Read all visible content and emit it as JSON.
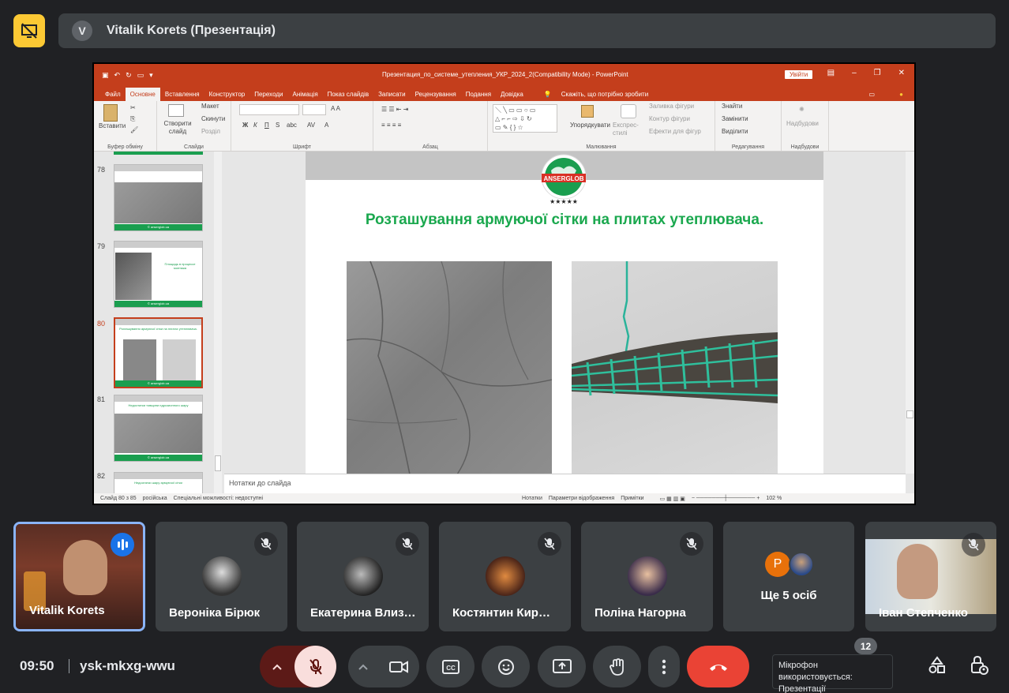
{
  "colors": {
    "accent": "#8ab4f8",
    "present_yellow": "#fcc934",
    "end_call": "#ea4335",
    "mic_muted_bg": "#f9dedc",
    "ppt_red": "#c43e1c",
    "slide_green": "#1aa84e"
  },
  "presenter": {
    "avatar_letter": "V",
    "title": "Vitalik Korets (Презентація)"
  },
  "ppt": {
    "doc_title": "Презентация_по_системе_утепления_УКР_2024_2(Compatibility Mode)  -  PowerPoint",
    "signin": "Увійти",
    "tabs": [
      "Файл",
      "Основне",
      "Вставлення",
      "Конструктор",
      "Переходи",
      "Анімація",
      "Показ слайдів",
      "Записати",
      "Рецензування",
      "Подання",
      "Довідка"
    ],
    "active_tab": "Основне",
    "tell_me": "Скажіть, що потрібно зробити",
    "ribbon": {
      "paste": "Вставити",
      "new_slide": "Створити слайд",
      "layout": "Макет",
      "reset": "Скинути",
      "section": "Розділ",
      "font_label": "Шрифт",
      "paragraph_label": "Абзац",
      "clipboard_label": "Буфер обміну",
      "slides_label": "Слайди",
      "drawing_label": "Малювання",
      "arrange": "Упорядкувати",
      "quick_styles": "Експрес-стилі",
      "fill": "Заливка фігури",
      "outline": "Контур фігури",
      "effects": "Ефекти для фігур",
      "find": "Знайти",
      "replace": "Замінити",
      "select": "Виділити",
      "editing_label": "Редагування",
      "addins": "Надбудови",
      "addins_label": "Надбудови"
    },
    "thumbnails": [
      {
        "num": "78",
        "title": "",
        "footer": "© anserglob.ua"
      },
      {
        "num": "79",
        "title": "Площадь в процессе монтажа",
        "footer": "© anserglob.ua"
      },
      {
        "num": "80",
        "title": "Розташування армуючої сітки на плитах утеплювача.",
        "footer": "© anserglob.ua"
      },
      {
        "num": "81",
        "title": "Недоотатки товщини пдрозионного шару",
        "footer": "© anserglob.ua"
      },
      {
        "num": "82",
        "title": "Недоотатки шару армуючої сітки",
        "footer": ""
      }
    ],
    "slide": {
      "logo_text": "ANSERGLOB",
      "title": "Розташування армуючої сітки на плитах утеплювача."
    },
    "notes": "Нотатки до слайда",
    "status": {
      "slide": "Слайд 80 з 85",
      "lang": "російська",
      "access": "Спеціальні можливості: недоступні",
      "notes": "Нотатки",
      "view": "Параметри відображення",
      "comments": "Примітки",
      "zoom": "102 %"
    }
  },
  "participants": [
    {
      "name": "Vitalik Korets",
      "state": "speaking"
    },
    {
      "name": "Вероніка Бірюк",
      "state": "muted"
    },
    {
      "name": "Екатерина Влиз…",
      "state": "muted"
    },
    {
      "name": "Костянтин Кир…",
      "state": "muted"
    },
    {
      "name": "Поліна Нагорна",
      "state": "muted"
    },
    {
      "name": "Ще 5 осіб",
      "state": "muted",
      "avatar_letter": "P"
    },
    {
      "name": "Іван Степченко",
      "state": "muted"
    }
  ],
  "bottom": {
    "time": "09:50",
    "meeting_code": "ysk-mkxg-wwu",
    "tooltip": "Мікрофон використовується: Презентації",
    "participant_count": "12"
  }
}
